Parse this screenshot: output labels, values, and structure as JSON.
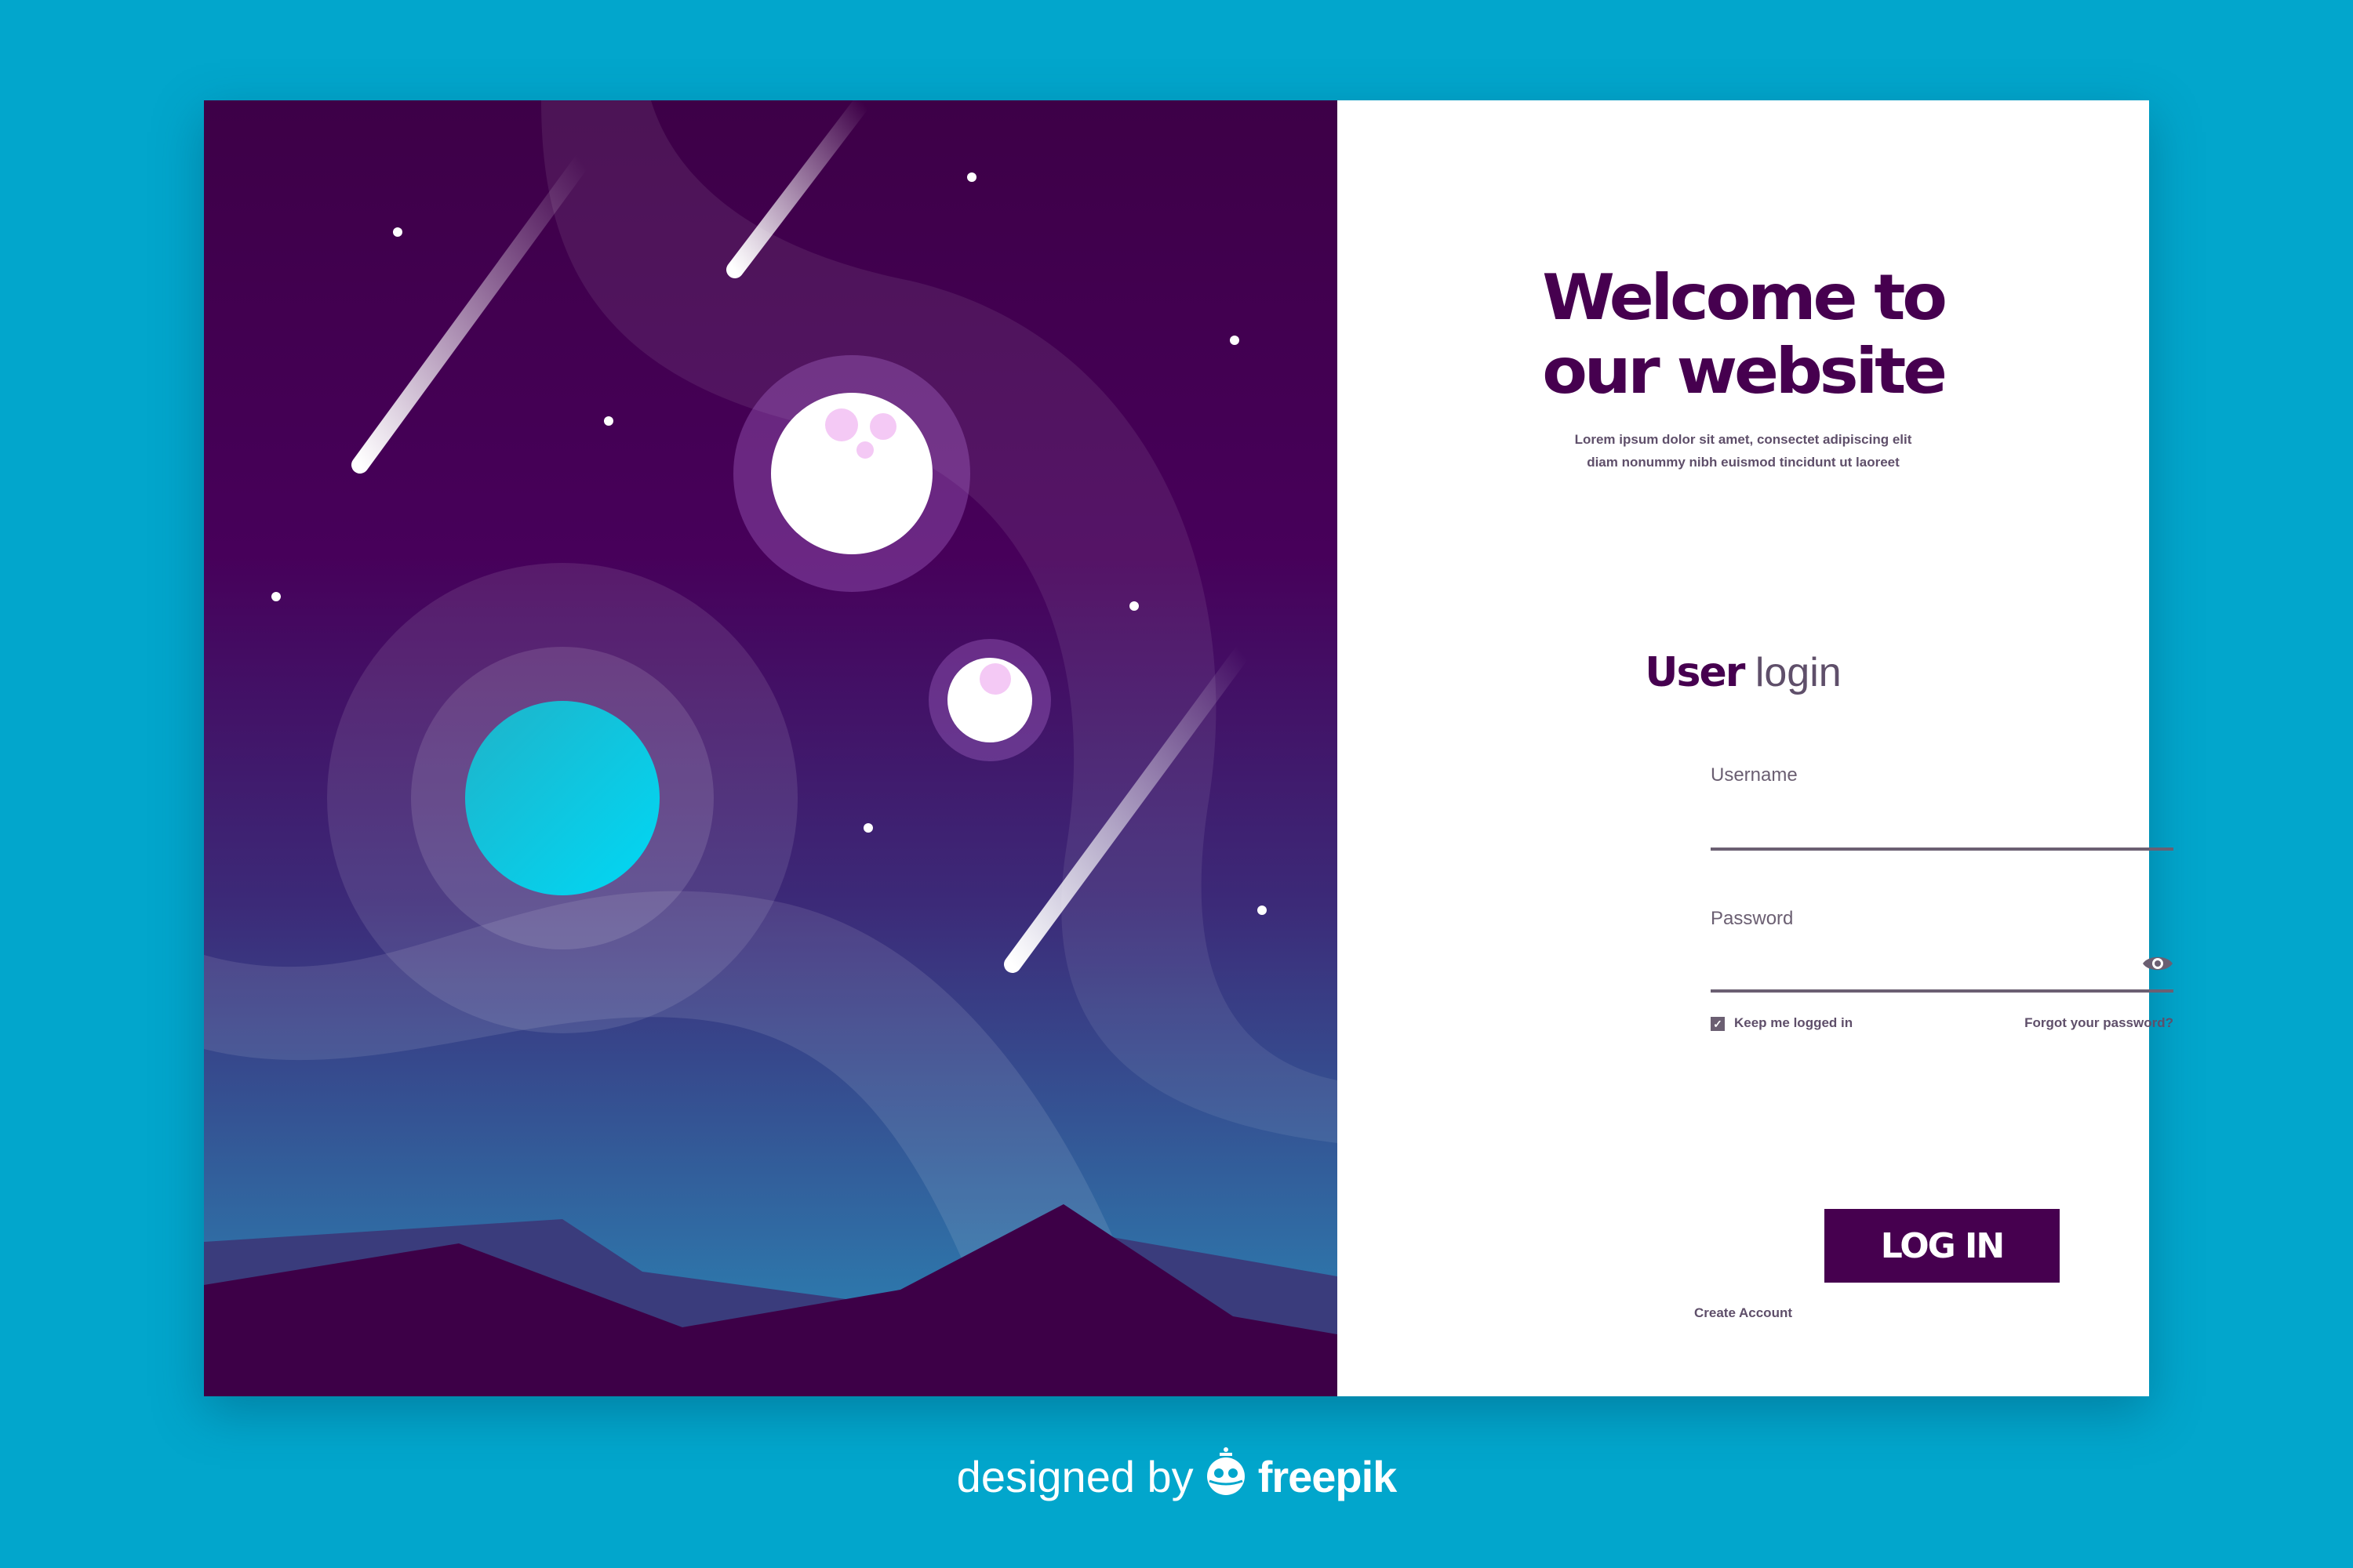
{
  "hero": {
    "title_line1": "Welcome to",
    "title_line2": "our website",
    "subtitle_line1": "Lorem ipsum dolor sit amet, consectet adipiscing elit",
    "subtitle_line2": "diam nonummy nibh euismod tincidunt ut laoreet"
  },
  "login": {
    "heading_bold": "User",
    "heading_light": "login",
    "username_label": "Username",
    "username_value": "",
    "password_label": "Password",
    "password_value": "",
    "password_toggle_icon": "eye-icon",
    "keep_logged_in_label": "Keep me logged in",
    "keep_logged_in_checked": true,
    "forgot_password_link": "Forgot your password?",
    "login_button": "LOG IN",
    "create_account_link": "Create Account"
  },
  "footer": {
    "designed_by": "designed by",
    "brand": "freepik"
  },
  "colors": {
    "background": "#02a6cc",
    "primary": "#46004f",
    "text_muted": "#5f4f6a"
  }
}
